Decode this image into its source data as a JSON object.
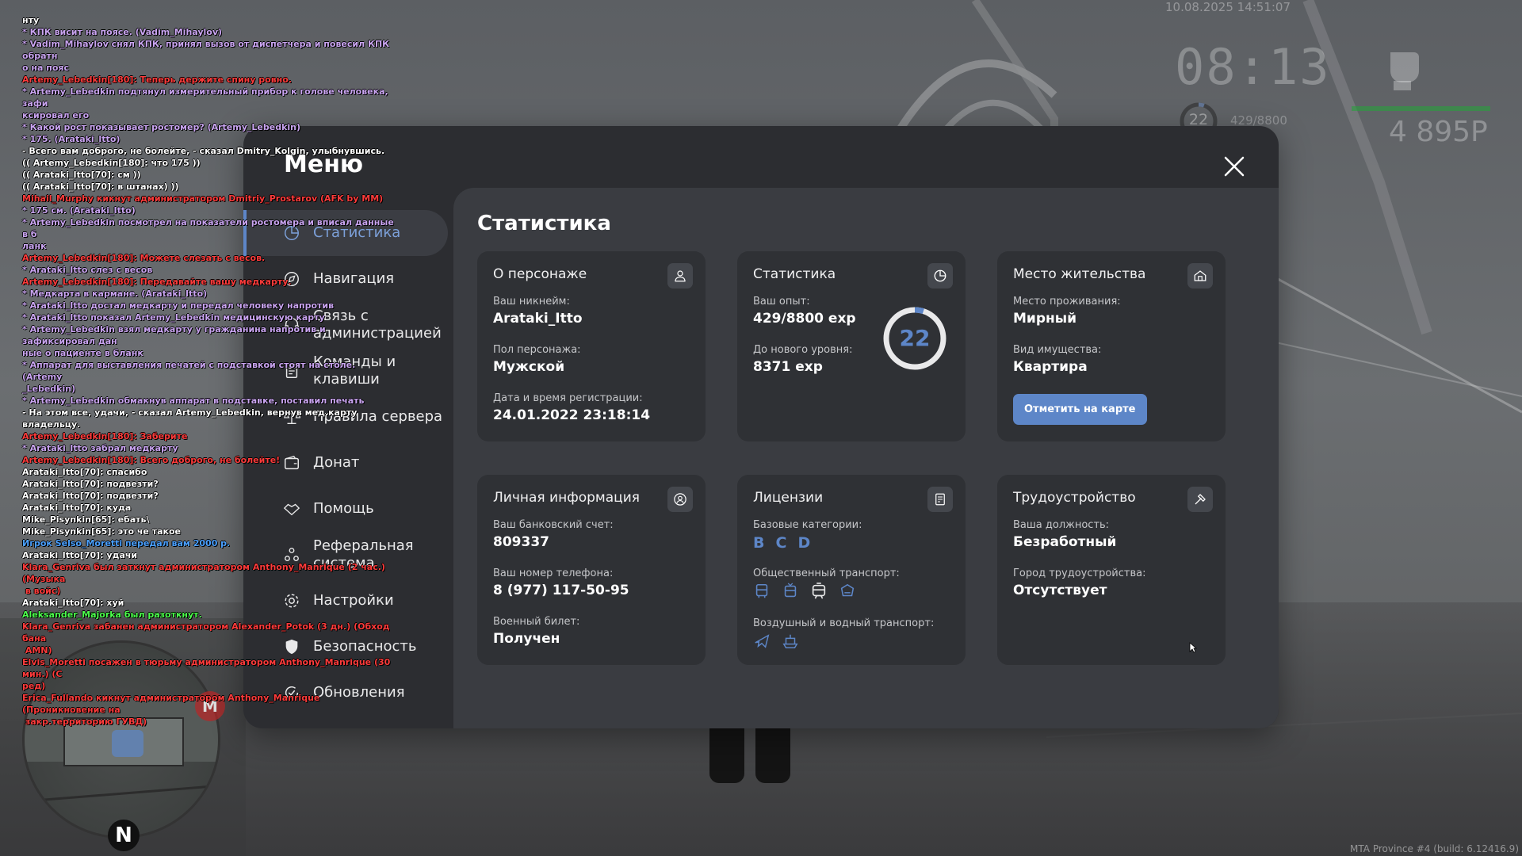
{
  "colors": {
    "accent": "#5d86c8",
    "panel_bg": "#2c2d31",
    "content_bg": "#3a3c41",
    "card_bg": "#2f3135"
  },
  "hud": {
    "date": "10.08.2025 14:51:07",
    "time": "08:13",
    "level": "22",
    "exp": "429/8800",
    "money": "4 895Р",
    "build": "MTA Province #4 (build: 6.12416.9)",
    "radar_north": "N",
    "radar_marker": "M",
    "icons": [
      "fist-icon"
    ]
  },
  "chat": [
    {
      "c": "white",
      "t": "нту"
    },
    {
      "c": "purple",
      "t": "* КПК висит на поясе. (Vadim_Mihaylov)"
    },
    {
      "c": "purple",
      "t": "* Vadim_Mihaylov снял КПК, принял вызов от диспетчера и повесил КПК обратн\nо на пояс"
    },
    {
      "c": "red",
      "t": "Artemy_Lebedkin[180]: Теперь держите спину ровно."
    },
    {
      "c": "purple",
      "t": "* Artemy_Lebedkin подтянул измерительный прибор к голове человека, зафи\nксировал его"
    },
    {
      "c": "purple",
      "t": "* Какой рост показывает ростомер? (Artemy_Lebedkin)"
    },
    {
      "c": "purple",
      "t": "* 175. (Arataki_Itto)"
    },
    {
      "c": "white",
      "t": "- Всего вам доброго, не болейте, - сказал Dmitry_Kolgin, улыбнувшись."
    },
    {
      "c": "white",
      "t": "(( Artemy_Lebedkin[180]: что 175 ))"
    },
    {
      "c": "white",
      "t": "(( Arataki_Itto[70]: см ))"
    },
    {
      "c": "white",
      "t": "(( Arataki_Itto[70]: в штанах) ))"
    },
    {
      "c": "red",
      "t": "Mihail_Murphy кикнут администратором Dmitriy_Prostarov (AFK by MM)"
    },
    {
      "c": "purple",
      "t": "* 175 см. (Arataki_Itto)"
    },
    {
      "c": "purple",
      "t": "* Artemy_Lebedkin посмотрел на показатели ростомера и вписал данные в б\nланк"
    },
    {
      "c": "red",
      "t": "Artemy_Lebedkin[180]: Можете слезать с весов."
    },
    {
      "c": "purple",
      "t": "* Arataki_Itto слез с весов"
    },
    {
      "c": "red",
      "t": "Artemy_Lebedkin[180]: Передавайте вашу медкарту."
    },
    {
      "c": "purple",
      "t": "* Медкарта в кармане. (Arataki_Itto)"
    },
    {
      "c": "purple",
      "t": "* Arataki_Itto достал медкарту и передал человеку напротив"
    },
    {
      "c": "purple",
      "t": "* Arataki_Itto показал Artemy_Lebedkin медицинскую карту"
    },
    {
      "c": "purple",
      "t": "* Artemy_Lebedkin взял медкарту у гражданина напротив и зафиксировал дан\nные о пациенте в бланк"
    },
    {
      "c": "purple",
      "t": "* Аппарат для выставления печатей с подставкой стоят на столе. (Artemy\n_Lebedkin)"
    },
    {
      "c": "purple",
      "t": "* Artemy_Lebedkin обмакнув аппарат в подставке, поставил печать"
    },
    {
      "c": "white",
      "t": "- На этом все, удачи, - сказал Artemy_Lebedkin, вернув мед.карту владельцу."
    },
    {
      "c": "red",
      "t": "Artemy_Lebedkin[180]: Заберите"
    },
    {
      "c": "purple",
      "t": "* Arataki_Itto забрал медкарту"
    },
    {
      "c": "red",
      "t": "Artemy_Lebedkin[180]: Всего доброго, не болейте!"
    },
    {
      "c": "white",
      "t": "Arataki_Itto[70]: спасибо"
    },
    {
      "c": "white",
      "t": "Arataki_Itto[70]: подвезти?"
    },
    {
      "c": "white",
      "t": "Arataki_Itto[70]: подвезти?"
    },
    {
      "c": "white",
      "t": "Arataki_Itto[70]: куда"
    },
    {
      "c": "white",
      "t": "Mike_Pisynkin[65]: ебать\\"
    },
    {
      "c": "white",
      "t": "Mike_Pisynkin[65]: это че такое"
    },
    {
      "c": "blue",
      "t": "Игрок Selso_Moretti передал вам 2000 р."
    },
    {
      "c": "white",
      "t": "Arataki_Itto[70]: удачи"
    },
    {
      "c": "red",
      "t": "Klara_Genriva был заткнут администратором Anthony_Manrique (2 час.) (Музыка\n в войс)"
    },
    {
      "c": "white",
      "t": "Arataki_Itto[70]: хуй"
    },
    {
      "c": "green",
      "t": "Aleksander_Majorka был разоткнут."
    },
    {
      "c": "red",
      "t": "Klara_Genriva забанен администратором Alexander_Potok (3 дн.) (Обход бана\n AMN)"
    },
    {
      "c": "red",
      "t": "Elvis_Moretti посажен в тюрьму администратором Anthony_Manrique (30 мин.) (С\nред)"
    },
    {
      "c": "red",
      "t": "Erica_Fullando кикнут администратором Anthony_Manrique (Проникновение на\n закр.территорию ГУВД)"
    }
  ],
  "menu": {
    "title": "Меню",
    "close_icon": "close-icon",
    "nav": [
      {
        "id": "stats",
        "label": "Статистика",
        "icon": "pie-chart-icon",
        "active": true
      },
      {
        "id": "navigation",
        "label": "Навигация",
        "icon": "navigation-icon",
        "active": false
      },
      {
        "id": "admin",
        "label": "Связь с\nадминистрацией",
        "icon": "headset-icon",
        "active": false
      },
      {
        "id": "commands",
        "label": "Команды и\nклавиши",
        "icon": "document-icon",
        "active": false
      },
      {
        "id": "rules",
        "label": "Правила сервера",
        "icon": "scales-icon",
        "active": false
      },
      {
        "id": "donate",
        "label": "Донат",
        "icon": "wallet-icon",
        "active": false
      },
      {
        "id": "help",
        "label": "Помощь",
        "icon": "handshake-icon",
        "active": false
      },
      {
        "id": "referral",
        "label": "Реферальная\nсистема",
        "icon": "people-icon",
        "active": false
      },
      {
        "id": "settings",
        "label": "Настройки",
        "icon": "gear-icon",
        "active": false
      },
      {
        "id": "security",
        "label": "Безопасность",
        "icon": "shield-icon",
        "active": false
      },
      {
        "id": "updates",
        "label": "Обновления",
        "icon": "refresh-check-icon",
        "active": false
      }
    ]
  },
  "content": {
    "title": "Статистика",
    "character": {
      "title": "О персонаже",
      "icon": "user-icon",
      "nick_label": "Ваш никнейм:",
      "nick": "Arataki_Itto",
      "gender_label": "Пол персонажа:",
      "gender": "Мужской",
      "reg_label": "Дата и время регистрации:",
      "reg": "24.01.2022 23:18:14"
    },
    "stats": {
      "title": "Статистика",
      "icon": "pie-chart-icon",
      "exp_label": "Ваш опыт:",
      "exp": "429/8800 exp",
      "next_label": "До нового уровня:",
      "next": "8371 exp",
      "level": "22",
      "progress": 0.0488
    },
    "residence": {
      "title": "Место жительства",
      "icon": "home-icon",
      "place_label": "Место проживания:",
      "place": "Мирный",
      "type_label": "Вид имущества:",
      "type": "Квартира",
      "button": "Отметить на карте"
    },
    "personal": {
      "title": "Личная информация",
      "icon": "user-circle-icon",
      "bank_label": "Ваш банковский счет:",
      "bank": "809337",
      "phone_label": "Ваш номер телефона:",
      "phone": "8 (977) 117-50-95",
      "military_label": "Военный билет:",
      "military": "Получен"
    },
    "licenses": {
      "title": "Лицензии",
      "icon": "license-icon",
      "base_label": "Базовые категории:",
      "base": [
        "B",
        "C",
        "D"
      ],
      "public_label": "Общественный транспорт:",
      "public_icons": [
        "bus-icon",
        "trolleybus-icon",
        "tram-icon",
        "metro-icon"
      ],
      "air_label": "Воздушный и водный транспорт:",
      "air_icons": [
        "plane-icon",
        "boat-icon"
      ]
    },
    "job": {
      "title": "Трудоустройство",
      "icon": "hammer-icon",
      "position_label": "Ваша должность:",
      "position": "Безработный",
      "city_label": "Город трудоустройства:",
      "city": "Отсутствует"
    }
  }
}
